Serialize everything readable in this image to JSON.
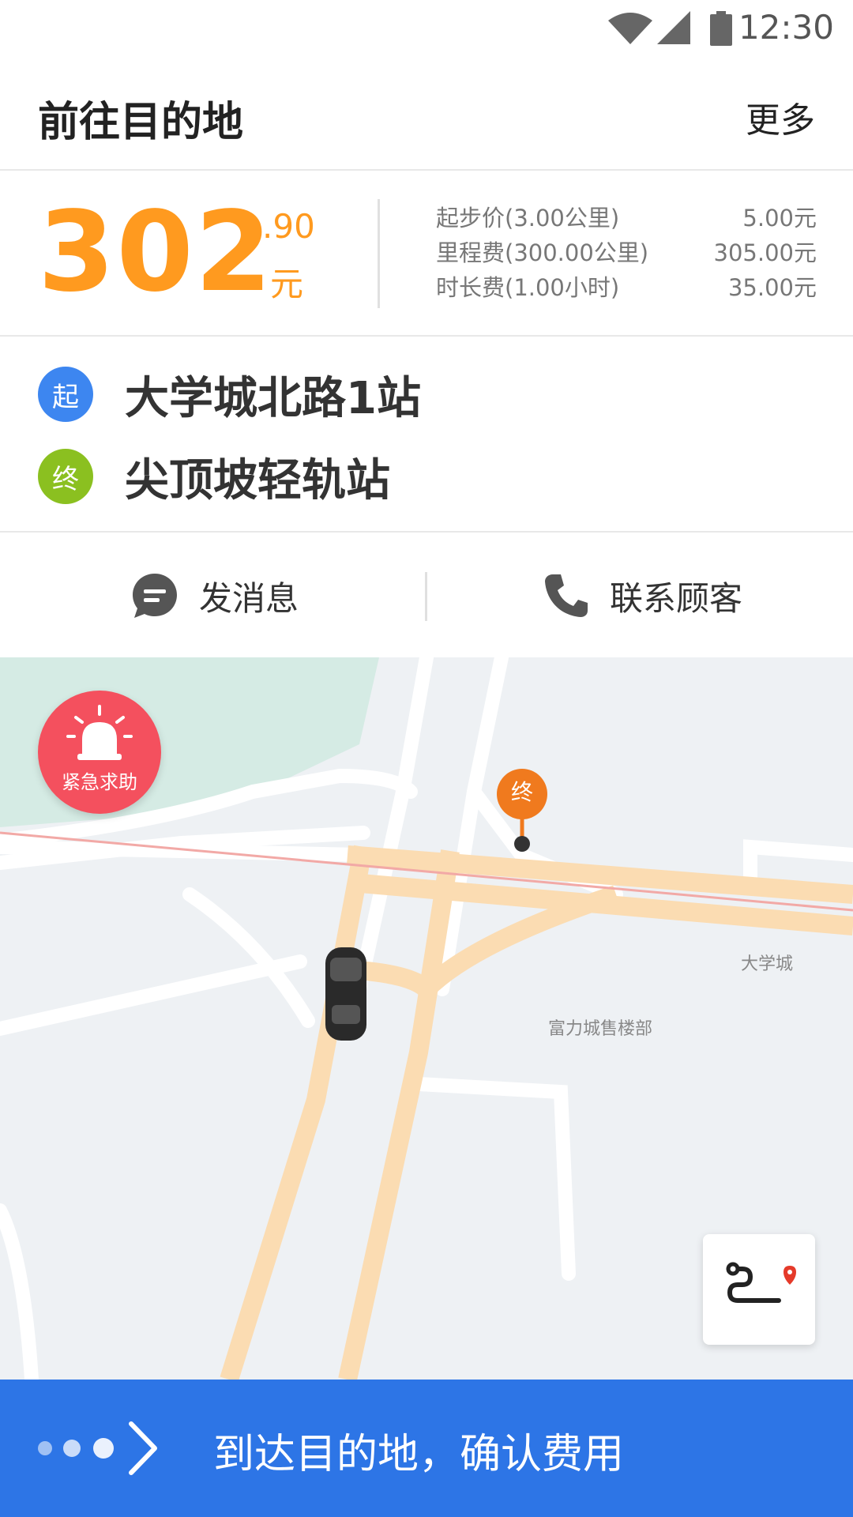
{
  "status_bar": {
    "time": "12:30"
  },
  "header": {
    "title": "前往目的地",
    "more_label": "更多"
  },
  "fare": {
    "amount_int": "302",
    "amount_dec": ".90",
    "unit": "元",
    "items": [
      {
        "label": "起步价(3.00公里)",
        "value": "5.00元"
      },
      {
        "label": "里程费(300.00公里)",
        "value": "305.00元"
      },
      {
        "label": "时长费(1.00小时)",
        "value": "35.00元"
      }
    ]
  },
  "route": {
    "start": {
      "badge": "起",
      "name": "大学城北路1站",
      "color": "#3d86f0"
    },
    "end": {
      "badge": "终",
      "name": "尖顶坡轻轨站",
      "color": "#8bc020"
    }
  },
  "actions": {
    "message_label": "发消息",
    "call_label": "联系顾客"
  },
  "map": {
    "sos_label": "紧急求助",
    "destination_marker": "终",
    "labels": {
      "area_1": "大学城",
      "area_2": "富力城售楼部"
    }
  },
  "bottom": {
    "cta_label": "到达目的地，确认费用"
  },
  "colors": {
    "accent": "#ff9a1f",
    "primary": "#2d75e6",
    "sos": "#f4505e",
    "marker": "#f07a1e"
  }
}
